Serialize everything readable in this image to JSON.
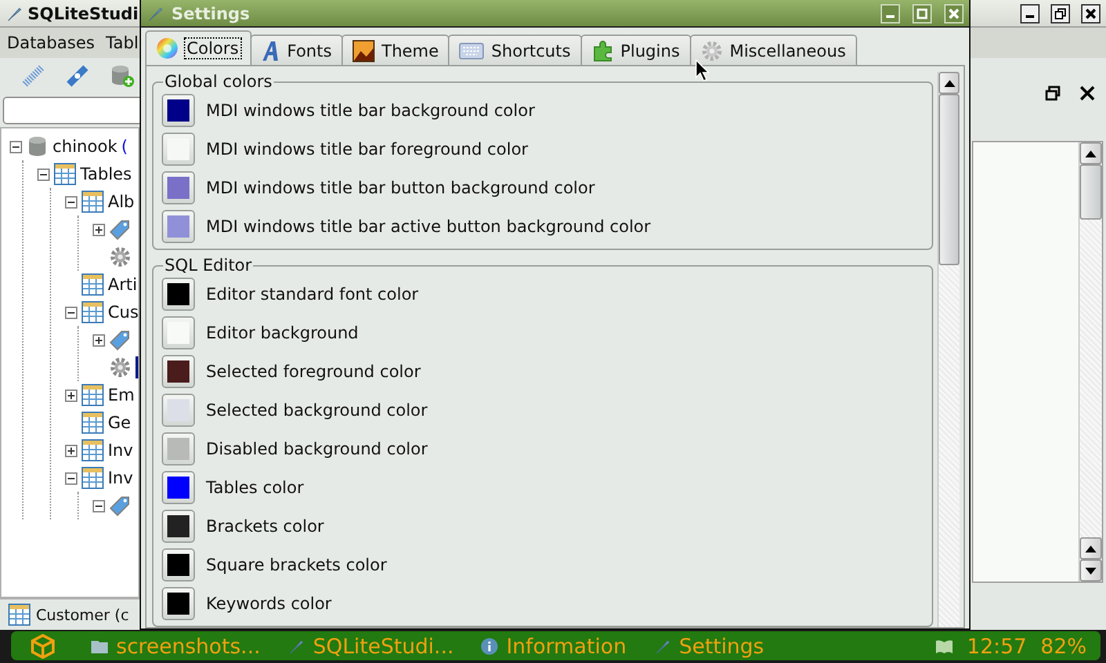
{
  "main_window": {
    "title": "SQLiteStudi",
    "menu": [
      "Databases",
      "Tabl"
    ],
    "tree": [
      {
        "kind": "database",
        "label": "chinook",
        "suffix": "(",
        "expanded": true,
        "children": [
          {
            "kind": "folder",
            "label": "Tables",
            "expanded": true,
            "children": [
              {
                "kind": "table",
                "label": "Alb",
                "expanded": true,
                "children": [
                  {
                    "kind": "index",
                    "expanded": false
                  },
                  {
                    "kind": "trigger"
                  }
                ]
              },
              {
                "kind": "table",
                "label": "Arti"
              },
              {
                "kind": "table",
                "label": "Cus",
                "expanded": true,
                "children": [
                  {
                    "kind": "index",
                    "expanded": false
                  },
                  {
                    "kind": "trigger",
                    "selected": true
                  }
                ]
              },
              {
                "kind": "table",
                "label": "Em",
                "expanded": false
              },
              {
                "kind": "table",
                "label": "Ge"
              },
              {
                "kind": "table",
                "label": "Inv",
                "expanded": false
              },
              {
                "kind": "table",
                "label": "Inv",
                "expanded": true,
                "children": [
                  {
                    "kind": "index",
                    "expanded": true
                  }
                ]
              }
            ]
          }
        ]
      }
    ],
    "bottom_tab": "Customer (c"
  },
  "settings": {
    "title": "Settings",
    "tabs": [
      {
        "label": "Colors",
        "kind": "colors",
        "selected": true
      },
      {
        "label": "Fonts",
        "kind": "fonts",
        "selected": false
      },
      {
        "label": "Theme",
        "kind": "theme",
        "selected": false
      },
      {
        "label": "Shortcuts",
        "kind": "shortcuts",
        "selected": false
      },
      {
        "label": "Plugins",
        "kind": "plugins",
        "selected": false
      },
      {
        "label": "Miscellaneous",
        "kind": "misc",
        "selected": false
      }
    ],
    "groups": [
      {
        "title": "Global colors",
        "items": [
          {
            "label": "MDI windows title bar background color",
            "color": "#000088"
          },
          {
            "label": "MDI windows title bar foreground color",
            "color": "#f5f8f5"
          },
          {
            "label": "MDI windows title bar button background color",
            "color": "#7a70c8"
          },
          {
            "label": "MDI windows title bar active button background color",
            "color": "#9090d8"
          }
        ]
      },
      {
        "title": "SQL Editor",
        "items": [
          {
            "label": "Editor standard font color",
            "color": "#000000"
          },
          {
            "label": "Editor background",
            "color": "#f8faf8"
          },
          {
            "label": "Selected foreground color",
            "color": "#4a1c1c"
          },
          {
            "label": "Selected background color",
            "color": "#dcdfe8"
          },
          {
            "label": "Disabled background color",
            "color": "#b8bab8"
          },
          {
            "label": "Tables color",
            "color": "#0000ff"
          },
          {
            "label": "Brackets color",
            "color": "#222222"
          },
          {
            "label": "Square brackets color",
            "color": "#000000"
          },
          {
            "label": "Keywords color",
            "color": "#000000"
          }
        ]
      }
    ]
  },
  "taskbar": {
    "items": [
      {
        "label": "screenshots...",
        "kind": "folder"
      },
      {
        "label": "SQLiteStudi...",
        "kind": "feather"
      },
      {
        "label": "Information",
        "kind": "info"
      },
      {
        "label": "Settings",
        "kind": "feather"
      }
    ],
    "clock": "12:57",
    "battery": "82%"
  }
}
